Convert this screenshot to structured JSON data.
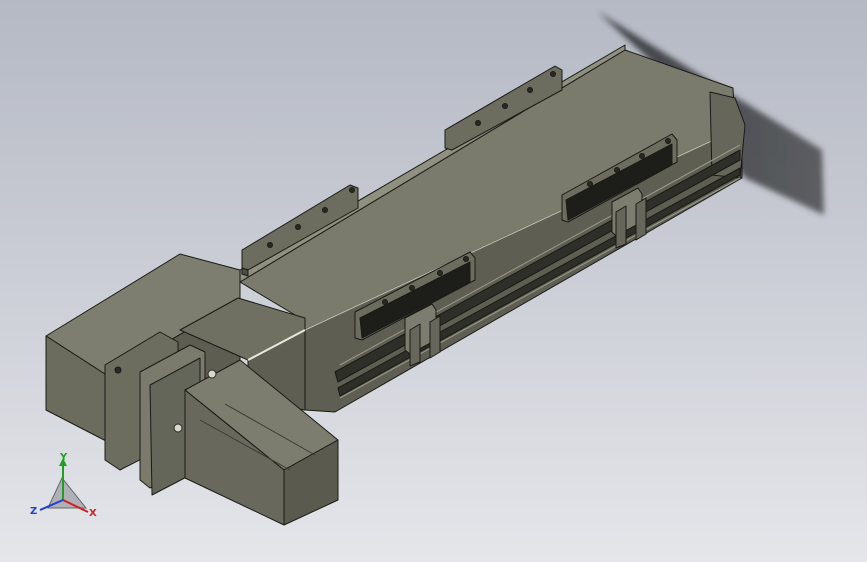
{
  "view": {
    "background_top": "#b5b9c4",
    "background_bottom": "#e4e6ea"
  },
  "model": {
    "body_color": "#6f7062",
    "dark_color": "#5a5b4e",
    "light_color": "#8b8c7d",
    "edge_color": "#1a1a16"
  },
  "triad": {
    "x_label": "X",
    "y_label": "Y",
    "z_label": "Z",
    "x_color": "#d02020",
    "y_color": "#20a020",
    "z_color": "#2040d0"
  }
}
